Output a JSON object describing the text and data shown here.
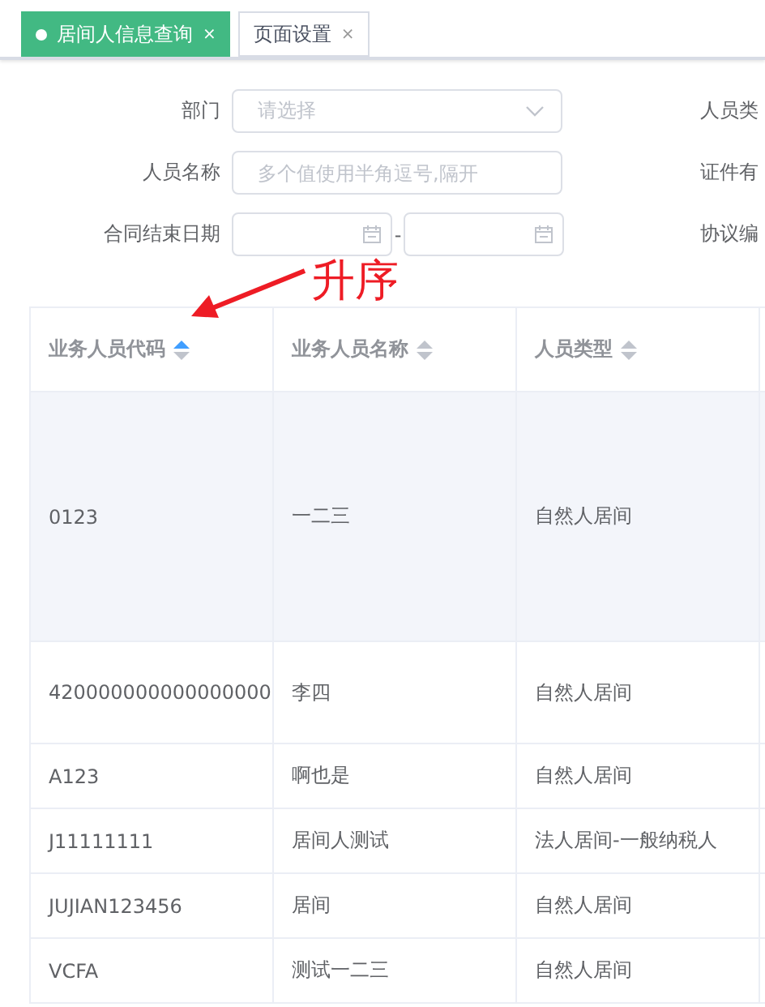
{
  "tabs": [
    {
      "label": "居间人信息查询",
      "selected": true,
      "close": "×"
    },
    {
      "label": "页面设置",
      "selected": false,
      "close": "×"
    }
  ],
  "form": {
    "rows": [
      {
        "kind": "select",
        "label": "部门",
        "placeholder": "请选择",
        "right_label": "人员类"
      },
      {
        "kind": "text",
        "label": "人员名称",
        "placeholder": "多个值使用半角逗号,隔开",
        "right_label": "证件有"
      },
      {
        "kind": "daterange",
        "label": "合同结束日期",
        "separator": "-",
        "right_label": "协议编"
      }
    ]
  },
  "table": {
    "columns": [
      {
        "label": "业务人员代码",
        "sorted_ascending": true
      },
      {
        "label": "业务人员名称",
        "sorted_ascending": false
      },
      {
        "label": "人员类型",
        "sorted_ascending": false
      }
    ],
    "rows": [
      {
        "cells": [
          "0123",
          "一二三",
          "自然人居间"
        ],
        "highlighted": true
      },
      {
        "cells": [
          "420000000000000000",
          "李四",
          "自然人居间"
        ],
        "highlighted": false
      },
      {
        "cells": [
          "A123",
          "啊也是",
          "自然人居间"
        ],
        "highlighted": false
      },
      {
        "cells": [
          "J11111111",
          "居间人测试",
          "法人居间-一般纳税人"
        ],
        "highlighted": false
      },
      {
        "cells": [
          "JUJIAN123456",
          "居间",
          "自然人居间"
        ],
        "highlighted": false
      },
      {
        "cells": [
          "VCFA",
          "测试一二三",
          "自然人居间"
        ],
        "highlighted": false
      }
    ]
  },
  "annotation": {
    "text": "升序"
  }
}
